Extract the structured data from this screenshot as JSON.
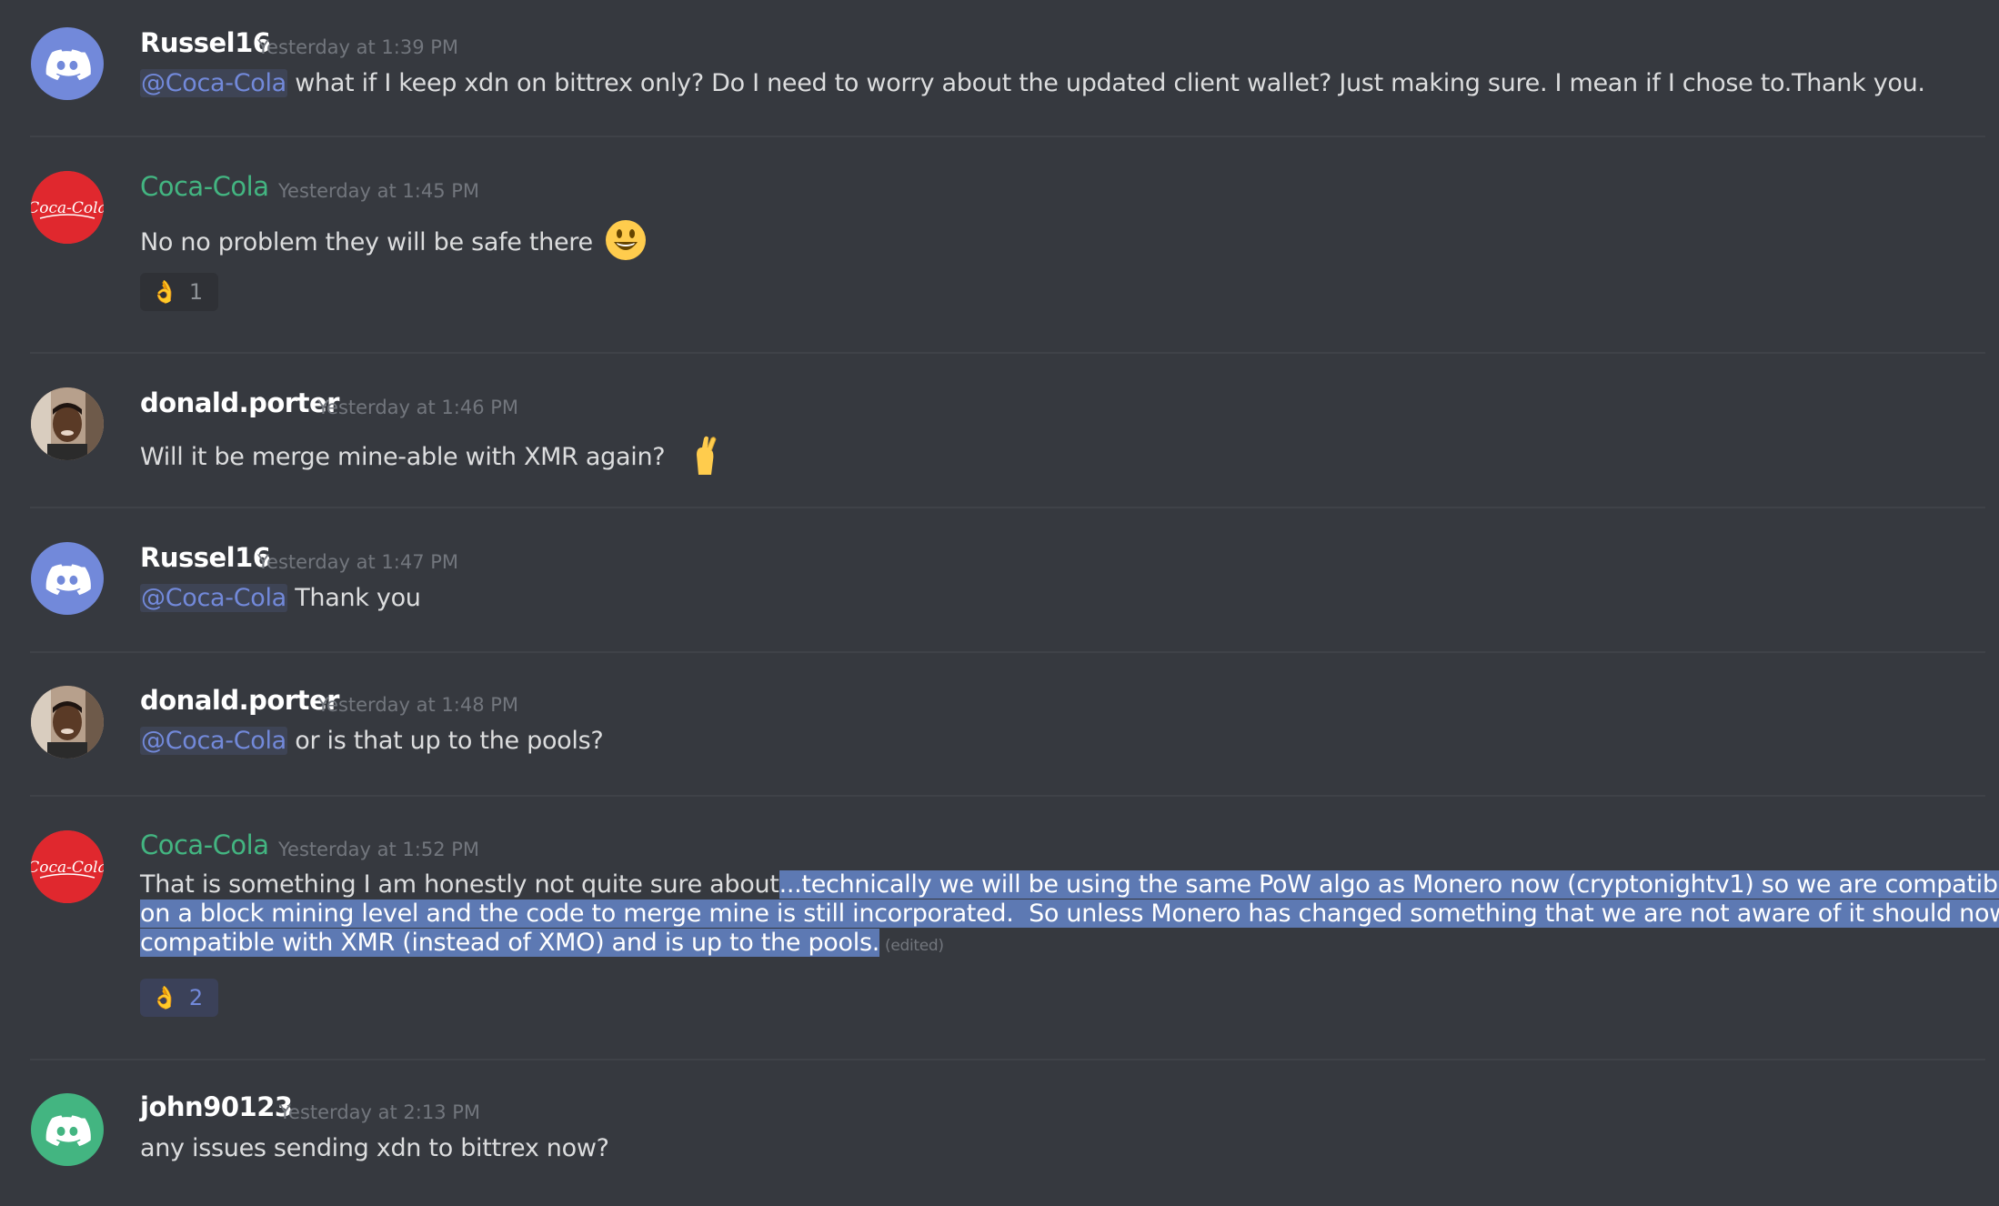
{
  "colors": {
    "background": "#36393f",
    "username_default": "#ffffff",
    "username_role": "#43b581",
    "mention": "#7289da",
    "selection": "#5d79b3",
    "timestamp": "#72767d"
  },
  "messages": [
    {
      "username": "Russel16",
      "timestamp": "Yesterday at 1:39 PM",
      "avatar_icon": "discord-logo-icon",
      "mention": "@Coca-Cola",
      "text": " what if I keep xdn on bittrex only? Do I need to worry about the updated client wallet? Just making sure. I mean if I chose to.Thank you."
    },
    {
      "username": "Coca-Cola",
      "timestamp": "Yesterday at 1:45 PM",
      "avatar_icon": "coca-cola-logo-icon",
      "text": "No no problem they will be safe there",
      "emoji": "smiley-emoji-icon",
      "reaction": {
        "emoji": "ok-hand-emoji-icon",
        "count": "1"
      }
    },
    {
      "username": "donald.porter",
      "timestamp": "Yesterday at 1:46 PM",
      "avatar_icon": "user-photo-avatar",
      "text": "Will it be merge mine-able with XMR again?",
      "emoji": "crossed-fingers-emoji-icon"
    },
    {
      "username": "Russel16",
      "timestamp": "Yesterday at 1:47 PM",
      "avatar_icon": "discord-logo-icon",
      "mention": "@Coca-Cola",
      "text": " Thank you"
    },
    {
      "username": "donald.porter",
      "timestamp": "Yesterday at 1:48 PM",
      "avatar_icon": "user-photo-avatar",
      "mention": "@Coca-Cola",
      "text": " or is that up to the pools?"
    },
    {
      "username": "Coca-Cola",
      "timestamp": "Yesterday at 1:52 PM",
      "avatar_icon": "coca-cola-logo-icon",
      "text_plain": "That is something I am honestly not quite sure about",
      "text_selected_1": "...technically we will be using the same PoW algo as Monero now (cryptonightv1) so we are compatible ",
      "text_selected_2": "on a block mining level and the code to merge mine is still incorporated.  So unless Monero has changed something that we are not aware of it should now be ",
      "text_selected_3": "compatible with XMR (instead of XMO) and is up to the pools.",
      "edited": "(edited)",
      "reaction": {
        "emoji": "ok-hand-emoji-icon",
        "count": "2"
      }
    },
    {
      "username": "john90123",
      "timestamp": "Yesterday at 2:13 PM",
      "avatar_icon": "discord-logo-icon",
      "text": "any issues sending xdn to bittrex now?"
    }
  ]
}
